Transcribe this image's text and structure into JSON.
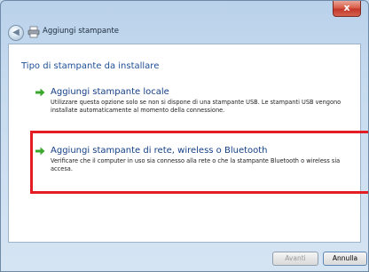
{
  "window": {
    "title": "Aggiungi stampante",
    "close_glyph": "x",
    "back_glyph": "◀"
  },
  "content": {
    "heading": "Tipo di stampante da installare",
    "options": [
      {
        "title": "Aggiungi stampante locale",
        "description": "Utilizzare questa opzione solo se non si dispone di una stampante USB. Le stampanti USB vengono installate automaticamente al momento della connessione."
      },
      {
        "title": "Aggiungi stampante di rete, wireless o Bluetooth",
        "description": "Verificare che il computer in uso sia connesso alla rete o che la stampante Bluetooth o wireless sia accesa."
      }
    ]
  },
  "buttons": {
    "next": "Avanti",
    "cancel": "Annulla"
  },
  "colors": {
    "highlight": "#e31d23",
    "arrow": "#3aa72d",
    "link": "#143f86"
  },
  "icons": {
    "back": "back-arrow-icon",
    "printer": "printer-icon",
    "option_arrow": "green-arrow-icon",
    "close": "close-icon"
  }
}
